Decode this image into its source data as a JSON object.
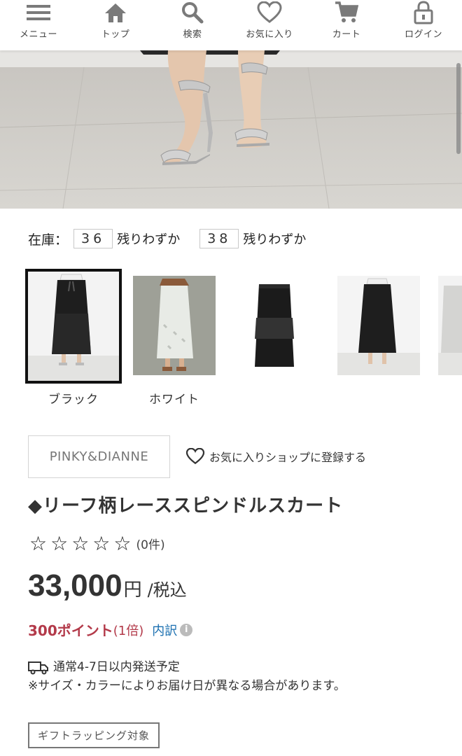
{
  "nav": {
    "items": [
      {
        "label": "メニュー",
        "icon": "menu-icon"
      },
      {
        "label": "トップ",
        "icon": "home-icon"
      },
      {
        "label": "検索",
        "icon": "search-icon"
      },
      {
        "label": "お気に入り",
        "icon": "heart-icon"
      },
      {
        "label": "カート",
        "icon": "cart-icon"
      },
      {
        "label": "ログイン",
        "icon": "lock-icon"
      }
    ],
    "icon_color": "#7a7a7a"
  },
  "stock": {
    "label": "在庫：",
    "sizes": [
      {
        "size": "36",
        "note": "残りわずか"
      },
      {
        "size": "38",
        "note": "残りわずか"
      }
    ]
  },
  "colors": {
    "options": [
      {
        "label": "ブラック",
        "selected": true
      },
      {
        "label": "ホワイト",
        "selected": false
      }
    ]
  },
  "shop": {
    "name": "PINKY&DIANNE",
    "favorite_label": "お気に入りショップに登録する"
  },
  "product": {
    "title": "◆リーフ柄レーススピンドルスカート",
    "rating_stars": "☆☆☆☆☆",
    "review_count": "(0件)",
    "price": "33,000",
    "currency": "円",
    "tax_label": "/税込",
    "points": "300ポイント",
    "points_multiplier": "(1倍)",
    "points_detail": "内訳"
  },
  "shipping": {
    "line1": "通常4-7日以内発送予定",
    "line2": "※サイズ・カラーによりお届け日が異なる場合があります。"
  },
  "gift_badge": "ギフトラッピング対象",
  "colors_theme": {
    "accent_points": "#b33a4a",
    "link_blue": "#1a6fb0"
  }
}
